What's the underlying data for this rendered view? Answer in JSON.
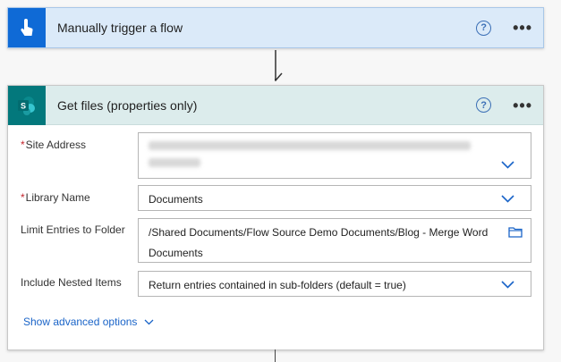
{
  "trigger": {
    "title": "Manually trigger a flow",
    "help_glyph": "?",
    "more_glyph": "•••",
    "icon": "touch-hand-icon",
    "color": "#0f6ad6"
  },
  "action": {
    "title": "Get files (properties only)",
    "help_glyph": "?",
    "more_glyph": "•••",
    "icon": "sharepoint-icon",
    "color": "#03787c",
    "fields": {
      "site_address": {
        "label": "Site Address",
        "required_mark": "*"
      },
      "library_name": {
        "label": "Library Name",
        "required_mark": "*",
        "value": "Documents"
      },
      "limit_folder": {
        "label": "Limit Entries to Folder",
        "value_line1": "/Shared Documents/Flow Source Demo Documents/Blog - Merge Word",
        "value_line2": "Documents"
      },
      "nested_items": {
        "label": "Include Nested Items",
        "value": "Return entries contained in sub-folders (default = true)"
      }
    },
    "advanced_label": "Show advanced options"
  }
}
